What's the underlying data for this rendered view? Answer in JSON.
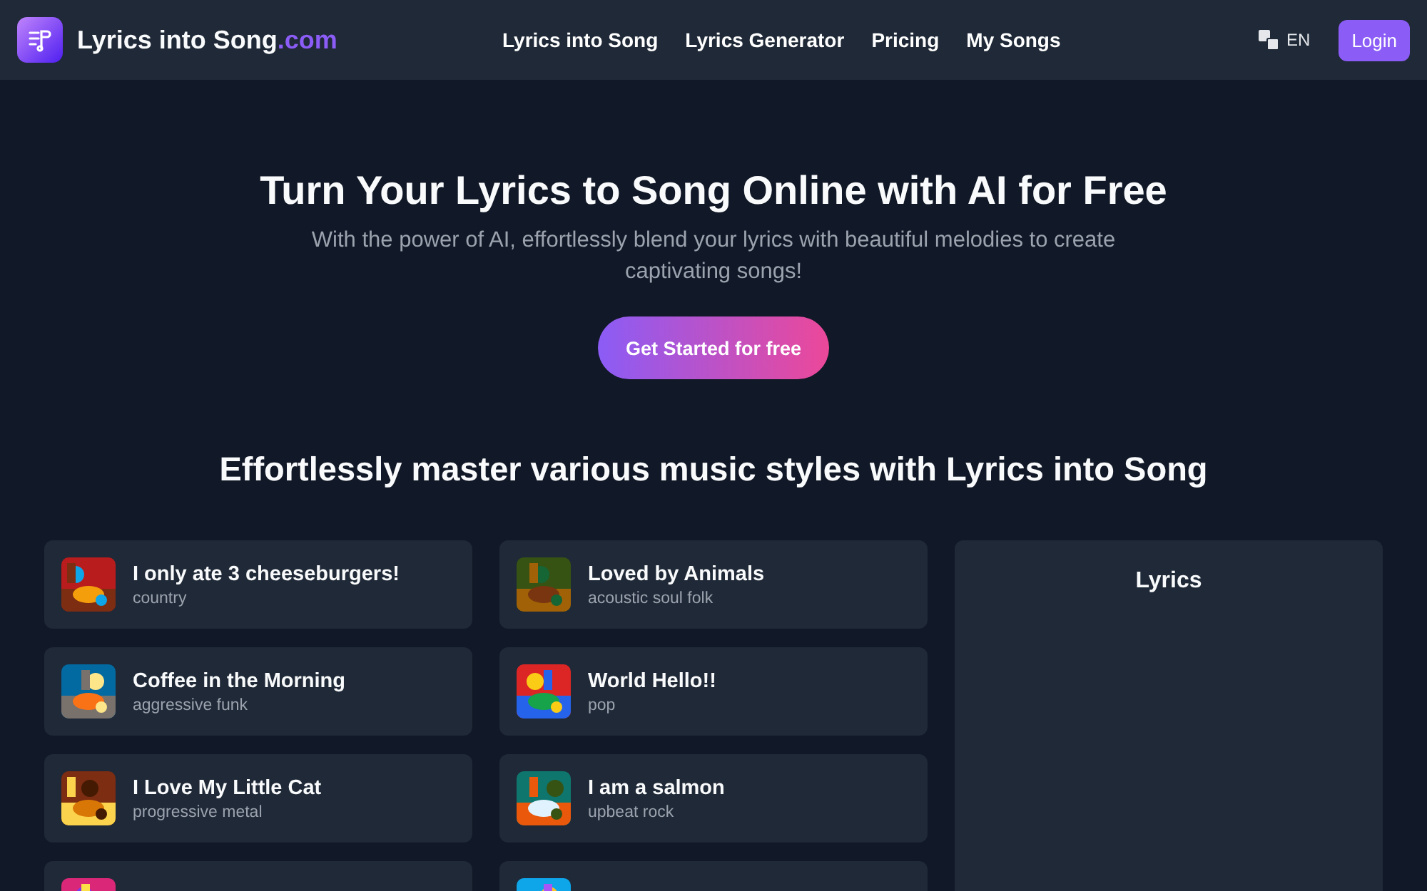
{
  "header": {
    "brand": "Lyrics into Song",
    "brand_suffix": ".com",
    "nav": [
      "Lyrics into Song",
      "Lyrics Generator",
      "Pricing",
      "My Songs"
    ],
    "language": "EN",
    "login": "Login"
  },
  "hero": {
    "title": "Turn Your Lyrics to Song Online with AI for Free",
    "subtitle": "With the power of AI, effortlessly blend your lyrics with beautiful melodies to create captivating songs!",
    "cta": "Get Started for free"
  },
  "styles": {
    "heading": "Effortlessly master various music styles with Lyrics into Song",
    "songs": [
      {
        "title": "I only ate 3 cheeseburgers!",
        "genre": "country",
        "picture": {
          "kind": "picture"
        }
      },
      {
        "title": "Loved by Animals",
        "genre": "acoustic soul folk",
        "picture": {
          "kind": "picture"
        }
      },
      {
        "title": "Coffee in the Morning",
        "genre": "aggressive funk",
        "picture": {
          "kind": "picture"
        }
      },
      {
        "title": "World Hello!!",
        "genre": "pop",
        "picture": {
          "kind": "picture"
        }
      },
      {
        "title": "I Love My Little Cat",
        "genre": "progressive metal",
        "picture": {
          "kind": "picture"
        }
      },
      {
        "title": "I am a salmon",
        "genre": "upbeat rock",
        "picture": {
          "kind": "picture"
        }
      },
      {
        "picture": {
          "kind": "picture"
        }
      },
      {
        "picture": {
          "kind": "picture"
        }
      }
    ],
    "lyrics_panel": {
      "title": "Lyrics"
    }
  }
}
